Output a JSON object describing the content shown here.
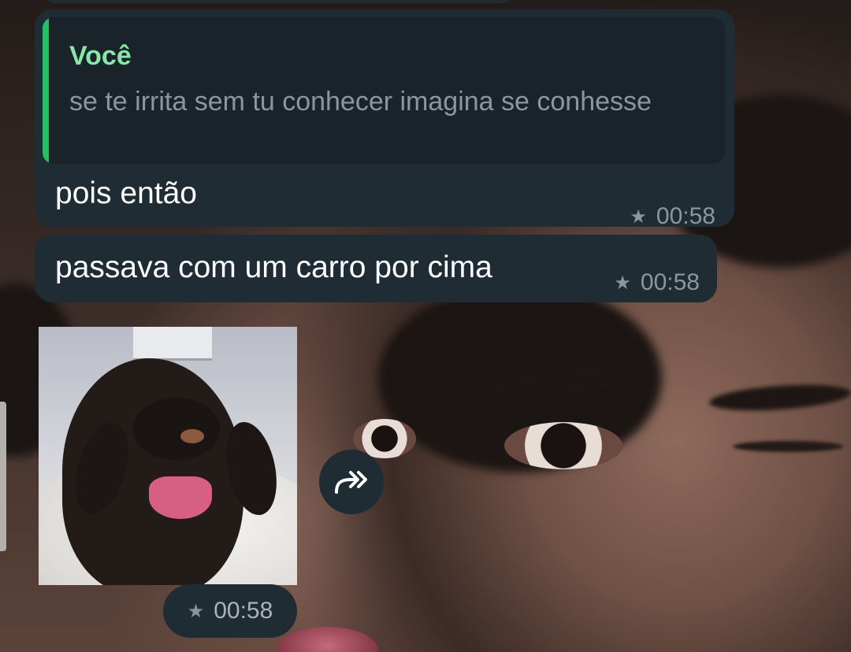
{
  "chat": {
    "quoted_message": {
      "author": "Você",
      "text": "se te irrita sem tu conhecer imagina se conhesse"
    },
    "messages": [
      {
        "text": "pois então",
        "time": "00:58",
        "starred": true
      },
      {
        "text": "passava com um carro por cima",
        "time": "00:58",
        "starred": true
      }
    ],
    "sticker": {
      "time": "00:58",
      "starred": true,
      "icon": "dachshund-sticker"
    }
  },
  "icons": {
    "star": "★",
    "forward": "forward-icon"
  },
  "colors": {
    "bubble": "#1f2c33",
    "quote_accent": "#21c063",
    "quote_author": "#8ae6a8",
    "meta_text": "#8a979e"
  }
}
